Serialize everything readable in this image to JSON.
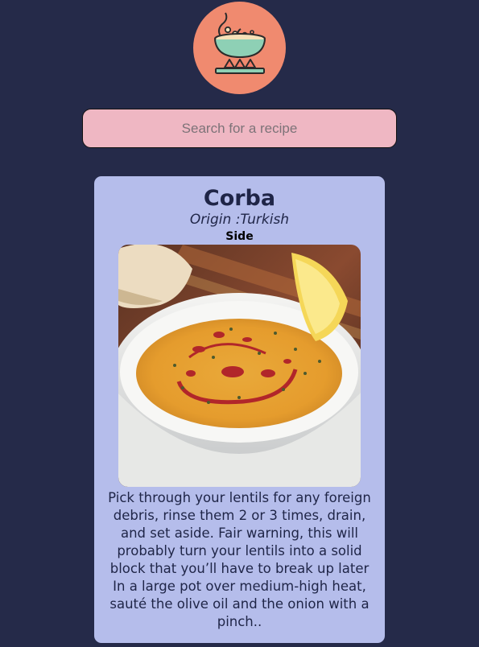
{
  "header": {
    "logo_icon": "cooking-pot-icon",
    "logo_color": "#f08a6f"
  },
  "search": {
    "placeholder": "Search for a recipe",
    "value": ""
  },
  "recipe": {
    "title": "Corba",
    "origin": "Origin :Turkish",
    "category": "Side",
    "image_icon": "soup-bowl-photo",
    "instructions": "Pick through your lentils for any foreign debris, rinse them 2 or 3 times, drain, and set aside. Fair warning, this will probably turn your lentils into a solid block that you’ll have to break up later In a large pot over medium-high heat, sauté the olive oil and the onion with a pinch.."
  },
  "colors": {
    "background": "#252a49",
    "search_bg": "#efb7c3",
    "card_bg": "#b5bdeb",
    "text": "#1f2547"
  }
}
